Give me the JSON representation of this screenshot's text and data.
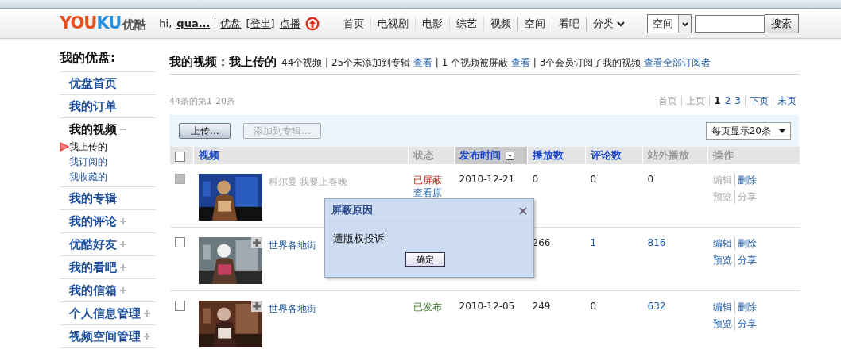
{
  "header": {
    "logo": {
      "parts": [
        "YOU",
        "KU"
      ],
      "name": "优酷"
    },
    "user": {
      "greeting": "hi,",
      "name": "qua...",
      "links": [
        "优盘",
        "[登出]",
        "点播"
      ]
    },
    "nav": [
      {
        "label": "首页",
        "kind": "link",
        "group_start": false
      },
      {
        "label": "电视剧",
        "kind": "link",
        "group_start": false
      },
      {
        "label": "电影",
        "kind": "link",
        "group_start": false
      },
      {
        "label": "综艺",
        "kind": "link",
        "group_start": false
      },
      {
        "label": "视频",
        "kind": "link",
        "group_start": false
      },
      {
        "label": "空间",
        "kind": "link",
        "group_start": true
      },
      {
        "label": "看吧",
        "kind": "link",
        "group_start": false
      },
      {
        "label": "分类",
        "kind": "menu",
        "group_start": true
      }
    ],
    "search": {
      "scope": "空间",
      "button": "搜索"
    }
  },
  "sidebar": {
    "title": "我的优盘:",
    "items": [
      {
        "label": "优盘首页",
        "kind": "link"
      },
      {
        "label": "我的订单",
        "kind": "link"
      },
      {
        "label": "我的视频",
        "kind": "folder",
        "expanded": true,
        "children": [
          {
            "label": "我上传的",
            "selected": true
          },
          {
            "label": "我订阅的",
            "selected": false
          },
          {
            "label": "我收藏的",
            "selected": false
          }
        ]
      },
      {
        "label": "我的专辑",
        "kind": "link"
      },
      {
        "label": "我的评论",
        "kind": "folder",
        "expanded": false
      },
      {
        "label": "优酷好友",
        "kind": "folder",
        "expanded": false
      },
      {
        "label": "我的看吧",
        "kind": "folder",
        "expanded": false
      },
      {
        "label": "我的信箱",
        "kind": "folder",
        "expanded": false
      },
      {
        "label": "个人信息管理",
        "kind": "folder",
        "expanded": false
      },
      {
        "label": "视频空间管理",
        "kind": "folder",
        "expanded": false
      }
    ]
  },
  "main": {
    "title": "我的视频：我上传的",
    "summary": [
      {
        "kind": "text",
        "text": "44个视频 | 25个未添加到专辑 "
      },
      {
        "kind": "link",
        "text": "查看"
      },
      {
        "kind": "text",
        "text": " | 1 个视频被屏蔽 "
      },
      {
        "kind": "link",
        "text": "查看"
      },
      {
        "kind": "text",
        "text": " | 3个会员订阅了我的视频 "
      },
      {
        "kind": "link",
        "text": "查看全部订阅者"
      }
    ],
    "range": "44条的第1-20条",
    "pagination": [
      {
        "label": "首页",
        "kind": "nav",
        "disabled": true
      },
      {
        "label": "上页",
        "kind": "nav",
        "disabled": true
      },
      {
        "label": "1",
        "kind": "page",
        "selected": true
      },
      {
        "label": "2",
        "kind": "page",
        "selected": false
      },
      {
        "label": "3",
        "kind": "page",
        "selected": false
      },
      {
        "label": "下页",
        "kind": "nav",
        "disabled": false
      },
      {
        "label": "末页",
        "kind": "nav",
        "disabled": false
      }
    ],
    "toolbar": {
      "buttons": [
        {
          "label": "上传...",
          "disabled": false
        },
        {
          "label": "添加到专辑...",
          "disabled": true
        }
      ],
      "page_size": "每页显示20条"
    },
    "table": {
      "select_all": {
        "checked": false
      },
      "columns": [
        {
          "label": "视频",
          "sortable": true,
          "selected": false
        },
        {
          "label": "状态",
          "sortable": false,
          "selected": false
        },
        {
          "label": "发布时间",
          "sortable": true,
          "selected": true
        },
        {
          "label": "播放数",
          "sortable": true,
          "selected": false
        },
        {
          "label": "评论数",
          "sortable": true,
          "selected": false
        },
        {
          "label": "站外播放",
          "sortable": false,
          "selected": false
        },
        {
          "label": "操作",
          "sortable": false,
          "selected": false
        }
      ],
      "rows": [
        {
          "checked": false,
          "disabled": true,
          "title": "科尔曼  我要上春晚",
          "status": {
            "kind": "blocked",
            "text": "已屏蔽",
            "link": "查看原"
          },
          "date": "2010-12-21",
          "plays": "0",
          "comments": "0",
          "offsite": "0",
          "actions": [
            {
              "label": "编辑",
              "disabled": true
            },
            {
              "label": "删除",
              "disabled": false
            },
            {
              "label": "预览",
              "disabled": true
            },
            {
              "label": "分享",
              "disabled": true
            }
          ]
        },
        {
          "checked": false,
          "disabled": false,
          "title": "世界各地街",
          "plays": "266",
          "comments": "1",
          "offsite": "816",
          "actions": [
            {
              "label": "编辑",
              "disabled": false
            },
            {
              "label": "删除",
              "disabled": false
            },
            {
              "label": "预览",
              "disabled": false
            },
            {
              "label": "分享",
              "disabled": false
            }
          ]
        },
        {
          "checked": false,
          "disabled": false,
          "title": "世界各地街",
          "status": {
            "kind": "published",
            "text": "已发布"
          },
          "date": "2010-12-05",
          "plays": "249",
          "comments": "0",
          "offsite": "632",
          "actions": [
            {
              "label": "编辑",
              "disabled": false
            },
            {
              "label": "删除",
              "disabled": false
            },
            {
              "label": "预览",
              "disabled": false
            },
            {
              "label": "分享",
              "disabled": false
            }
          ]
        }
      ]
    }
  },
  "dialog": {
    "title": "屏蔽原因",
    "message": "遭版权投诉",
    "button": "确定"
  }
}
